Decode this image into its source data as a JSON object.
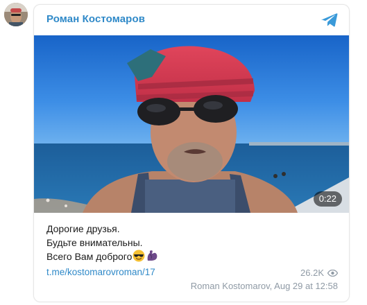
{
  "post": {
    "channel_name": "Роман Костомаров",
    "video_duration": "0:22",
    "text_lines": [
      "Дорогие друзья.",
      "Будьте внимательны.",
      "Всего Вам доброго"
    ],
    "emojis": [
      "smiling-face-with-sunglasses-icon",
      "flexed-biceps-icon"
    ],
    "link": "t.me/kostomarovroman/17",
    "views": "26.2K",
    "author_date": "Roman Kostomarov, Aug 29 at 12:58"
  },
  "colors": {
    "accent": "#2f89c8",
    "meta": "#8f9aa5"
  }
}
